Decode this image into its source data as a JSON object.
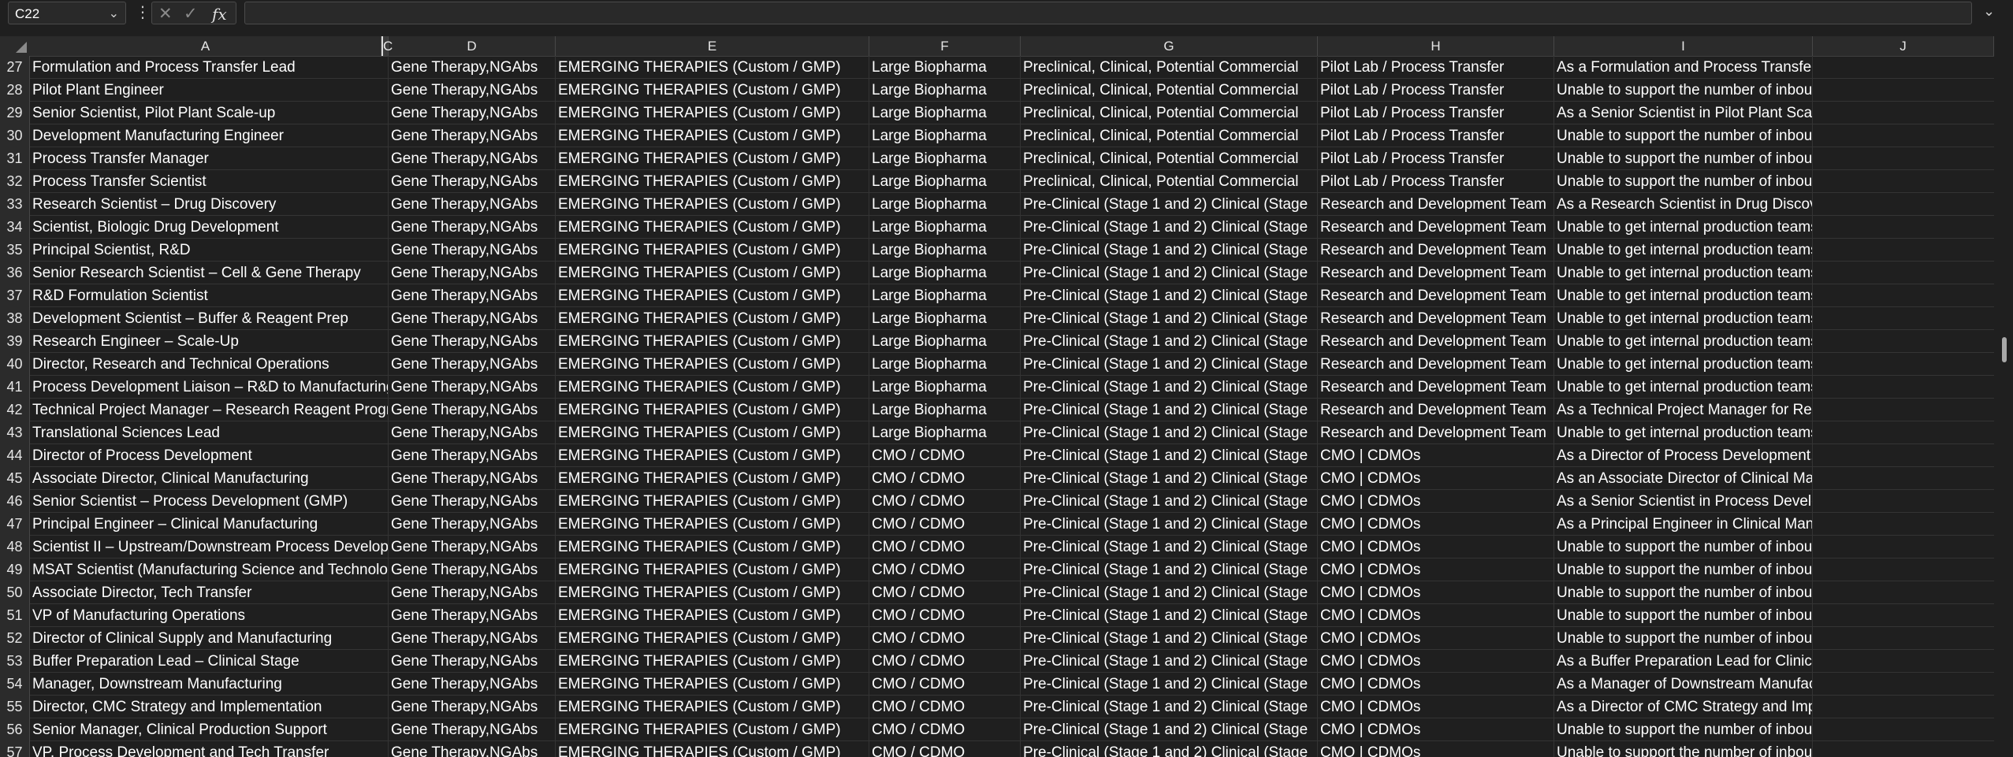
{
  "formula_bar": {
    "name_box": "C22",
    "formula": ""
  },
  "columns": [
    "",
    "A",
    "C",
    "D",
    "E",
    "F",
    "G",
    "H",
    "I",
    "J"
  ],
  "rows": [
    [
      "27",
      "Formulation and Process Transfer Lead",
      "Gene Therapy,NGAbs",
      "EMERGING THERAPIES (Custom / GMP)",
      "Large Biopharma",
      "Preclinical, Clinical, Potential Commercial",
      "Pilot Lab / Process Transfer",
      "As a Formulation and Process Transfer Lead, you're facing the"
    ],
    [
      "28",
      "Pilot Plant Engineer",
      "Gene Therapy,NGAbs",
      "EMERGING THERAPIES (Custom / GMP)",
      "Large Biopharma",
      "Preclinical, Clinical, Potential Commercial",
      "Pilot Lab / Process Transfer",
      "Unable to support the number of inbound project requests"
    ],
    [
      "29",
      "Senior Scientist, Pilot Plant Scale-up",
      "Gene Therapy,NGAbs",
      "EMERGING THERAPIES (Custom / GMP)",
      "Large Biopharma",
      "Preclinical, Clinical, Potential Commercial",
      "Pilot Lab / Process Transfer",
      "As a Senior Scientist in Pilot Plant Scale-up, you're tasked with"
    ],
    [
      "30",
      "Development Manufacturing Engineer",
      "Gene Therapy,NGAbs",
      "EMERGING THERAPIES (Custom / GMP)",
      "Large Biopharma",
      "Preclinical, Clinical, Potential Commercial",
      "Pilot Lab / Process Transfer",
      "Unable to support the number of inbound project requests"
    ],
    [
      "31",
      "Process Transfer Manager",
      "Gene Therapy,NGAbs",
      "EMERGING THERAPIES (Custom / GMP)",
      "Large Biopharma",
      "Preclinical, Clinical, Potential Commercial",
      "Pilot Lab / Process Transfer",
      "Unable to support the number of inbound project requests"
    ],
    [
      "32",
      "Process Transfer Scientist",
      "Gene Therapy,NGAbs",
      "EMERGING THERAPIES (Custom / GMP)",
      "Large Biopharma",
      "Preclinical, Clinical, Potential Commercial",
      "Pilot Lab / Process Transfer",
      "Unable to support the number of inbound project requests"
    ],
    [
      "33",
      "Research Scientist – Drug Discovery",
      "Gene Therapy,NGAbs",
      "EMERGING THERAPIES (Custom / GMP)",
      "Large Biopharma",
      "Pre-Clinical (Stage 1 and 2) Clinical (Stage",
      "Research and Development Team",
      "As a Research Scientist in Drug Discovery, you require consiste"
    ],
    [
      "34",
      "Scientist, Biologic Drug Development",
      "Gene Therapy,NGAbs",
      "EMERGING THERAPIES (Custom / GMP)",
      "Large Biopharma",
      "Pre-Clinical (Stage 1 and 2) Clinical (Stage",
      "Research and Development Team",
      "Unable to get internal production teams to take on their proje"
    ],
    [
      "35",
      "Principal Scientist, R&D",
      "Gene Therapy,NGAbs",
      "EMERGING THERAPIES (Custom / GMP)",
      "Large Biopharma",
      "Pre-Clinical (Stage 1 and 2) Clinical (Stage",
      "Research and Development Team",
      "Unable to get internal production teams to take on their proje"
    ],
    [
      "36",
      "Senior Research Scientist – Cell & Gene Therapy",
      "Gene Therapy,NGAbs",
      "EMERGING THERAPIES (Custom / GMP)",
      "Large Biopharma",
      "Pre-Clinical (Stage 1 and 2) Clinical (Stage",
      "Research and Development Team",
      "Unable to get internal production teams to take on their proje"
    ],
    [
      "37",
      "R&D Formulation Scientist",
      "Gene Therapy,NGAbs",
      "EMERGING THERAPIES (Custom / GMP)",
      "Large Biopharma",
      "Pre-Clinical (Stage 1 and 2) Clinical (Stage",
      "Research and Development Team",
      "Unable to get internal production teams to take on their proje"
    ],
    [
      "38",
      "Development Scientist – Buffer & Reagent Prep",
      "Gene Therapy,NGAbs",
      "EMERGING THERAPIES (Custom / GMP)",
      "Large Biopharma",
      "Pre-Clinical (Stage 1 and 2) Clinical (Stage",
      "Research and Development Team",
      "Unable to get internal production teams to take on their proje"
    ],
    [
      "39",
      "Research Engineer – Scale-Up",
      "Gene Therapy,NGAbs",
      "EMERGING THERAPIES (Custom / GMP)",
      "Large Biopharma",
      "Pre-Clinical (Stage 1 and 2) Clinical (Stage",
      "Research and Development Team",
      "Unable to get internal production teams to take on their proje"
    ],
    [
      "40",
      "Director, Research and Technical Operations",
      "Gene Therapy,NGAbs",
      "EMERGING THERAPIES (Custom / GMP)",
      "Large Biopharma",
      "Pre-Clinical (Stage 1 and 2) Clinical (Stage",
      "Research and Development Team",
      "Unable to get internal production teams to take on their proje"
    ],
    [
      "41",
      "Process Development Liaison – R&D to Manufacturing",
      "Gene Therapy,NGAbs",
      "EMERGING THERAPIES (Custom / GMP)",
      "Large Biopharma",
      "Pre-Clinical (Stage 1 and 2) Clinical (Stage",
      "Research and Development Team",
      "Unable to get internal production teams to take on their proje"
    ],
    [
      "42",
      "Technical Project Manager – Research Reagent Programs",
      "Gene Therapy,NGAbs",
      "EMERGING THERAPIES (Custom / GMP)",
      "Large Biopharma",
      "Pre-Clinical (Stage 1 and 2) Clinical (Stage",
      "Research and Development Team",
      "As a Technical Project Manager for Research Reagent Program"
    ],
    [
      "43",
      "Translational Sciences Lead",
      "Gene Therapy,NGAbs",
      "EMERGING THERAPIES (Custom / GMP)",
      "Large Biopharma",
      "Pre-Clinical (Stage 1 and 2) Clinical (Stage",
      "Research and Development Team",
      "Unable to get internal production teams to take on their proje"
    ],
    [
      "44",
      "Director of Process Development",
      "Gene Therapy,NGAbs",
      "EMERGING THERAPIES (Custom / GMP)",
      "CMO / CDMO",
      "Pre-Clinical (Stage 1 and 2) Clinical (Stage",
      "CMO | CDMOs",
      "As a Director of Process Development, you're balancing the co"
    ],
    [
      "45",
      "Associate Director, Clinical Manufacturing",
      "Gene Therapy,NGAbs",
      "EMERGING THERAPIES (Custom / GMP)",
      "CMO / CDMO",
      "Pre-Clinical (Stage 1 and 2) Clinical (Stage",
      "CMO | CDMOs",
      "As an Associate Director of Clinical Manufacturing, you're man"
    ],
    [
      "46",
      "Senior Scientist – Process Development (GMP)",
      "Gene Therapy,NGAbs",
      "EMERGING THERAPIES (Custom / GMP)",
      "CMO / CDMO",
      "Pre-Clinical (Stage 1 and 2) Clinical (Stage",
      "CMO | CDMOs",
      "As a Senior Scientist in Process Development (GMP), you're lik"
    ],
    [
      "47",
      "Principal Engineer – Clinical Manufacturing",
      "Gene Therapy,NGAbs",
      "EMERGING THERAPIES (Custom / GMP)",
      "CMO / CDMO",
      "Pre-Clinical (Stage 1 and 2) Clinical (Stage",
      "CMO | CDMOs",
      "As a Principal Engineer in Clinical Manufacturing, you're respo"
    ],
    [
      "48",
      "Scientist II – Upstream/Downstream Process Development",
      "Gene Therapy,NGAbs",
      "EMERGING THERAPIES (Custom / GMP)",
      "CMO / CDMO",
      "Pre-Clinical (Stage 1 and 2) Clinical (Stage",
      "CMO | CDMOs",
      "Unable to support the number of inbound project requests"
    ],
    [
      "49",
      "MSAT Scientist (Manufacturing Science and Technology)",
      "Gene Therapy,NGAbs",
      "EMERGING THERAPIES (Custom / GMP)",
      "CMO / CDMO",
      "Pre-Clinical (Stage 1 and 2) Clinical (Stage",
      "CMO | CDMOs",
      "Unable to support the number of inbound project requests"
    ],
    [
      "50",
      "Associate Director, Tech Transfer",
      "Gene Therapy,NGAbs",
      "EMERGING THERAPIES (Custom / GMP)",
      "CMO / CDMO",
      "Pre-Clinical (Stage 1 and 2) Clinical (Stage",
      "CMO | CDMOs",
      "Unable to support the number of inbound project requests"
    ],
    [
      "51",
      "VP of Manufacturing Operations",
      "Gene Therapy,NGAbs",
      "EMERGING THERAPIES (Custom / GMP)",
      "CMO / CDMO",
      "Pre-Clinical (Stage 1 and 2) Clinical (Stage",
      "CMO | CDMOs",
      "Unable to support the number of inbound project requests"
    ],
    [
      "52",
      "Director of Clinical Supply and Manufacturing",
      "Gene Therapy,NGAbs",
      "EMERGING THERAPIES (Custom / GMP)",
      "CMO / CDMO",
      "Pre-Clinical (Stage 1 and 2) Clinical (Stage",
      "CMO | CDMOs",
      "Unable to support the number of inbound project requests"
    ],
    [
      "53",
      "Buffer Preparation Lead – Clinical Stage",
      "Gene Therapy,NGAbs",
      "EMERGING THERAPIES (Custom / GMP)",
      "CMO / CDMO",
      "Pre-Clinical (Stage 1 and 2) Clinical (Stage",
      "CMO | CDMOs",
      "As a Buffer Preparation Lead for Clinical Stage projects, you'r"
    ],
    [
      "54",
      "Manager, Downstream Manufacturing",
      "Gene Therapy,NGAbs",
      "EMERGING THERAPIES (Custom / GMP)",
      "CMO / CDMO",
      "Pre-Clinical (Stage 1 and 2) Clinical (Stage",
      "CMO | CDMOs",
      "As a Manager of Downstream Manufacturing, you're respons"
    ],
    [
      "55",
      "Director, CMC Strategy and Implementation",
      "Gene Therapy,NGAbs",
      "EMERGING THERAPIES (Custom / GMP)",
      "CMO / CDMO",
      "Pre-Clinical (Stage 1 and 2) Clinical (Stage",
      "CMO | CDMOs",
      "As a Director of CMC Strategy and Implementation, you're re"
    ],
    [
      "56",
      "Senior Manager, Clinical Production Support",
      "Gene Therapy,NGAbs",
      "EMERGING THERAPIES (Custom / GMP)",
      "CMO / CDMO",
      "Pre-Clinical (Stage 1 and 2) Clinical (Stage",
      "CMO | CDMOs",
      "Unable to support the number of inbound project requests"
    ],
    [
      "57",
      "VP, Process Development and Tech Transfer",
      "Gene Therapy,NGAbs",
      "EMERGING THERAPIES (Custom / GMP)",
      "CMO / CDMO",
      "Pre-Clinical (Stage 1 and 2) Clinical (Stage",
      "CMO | CDMOs",
      "Unable to support the number of inbound project requests"
    ]
  ]
}
